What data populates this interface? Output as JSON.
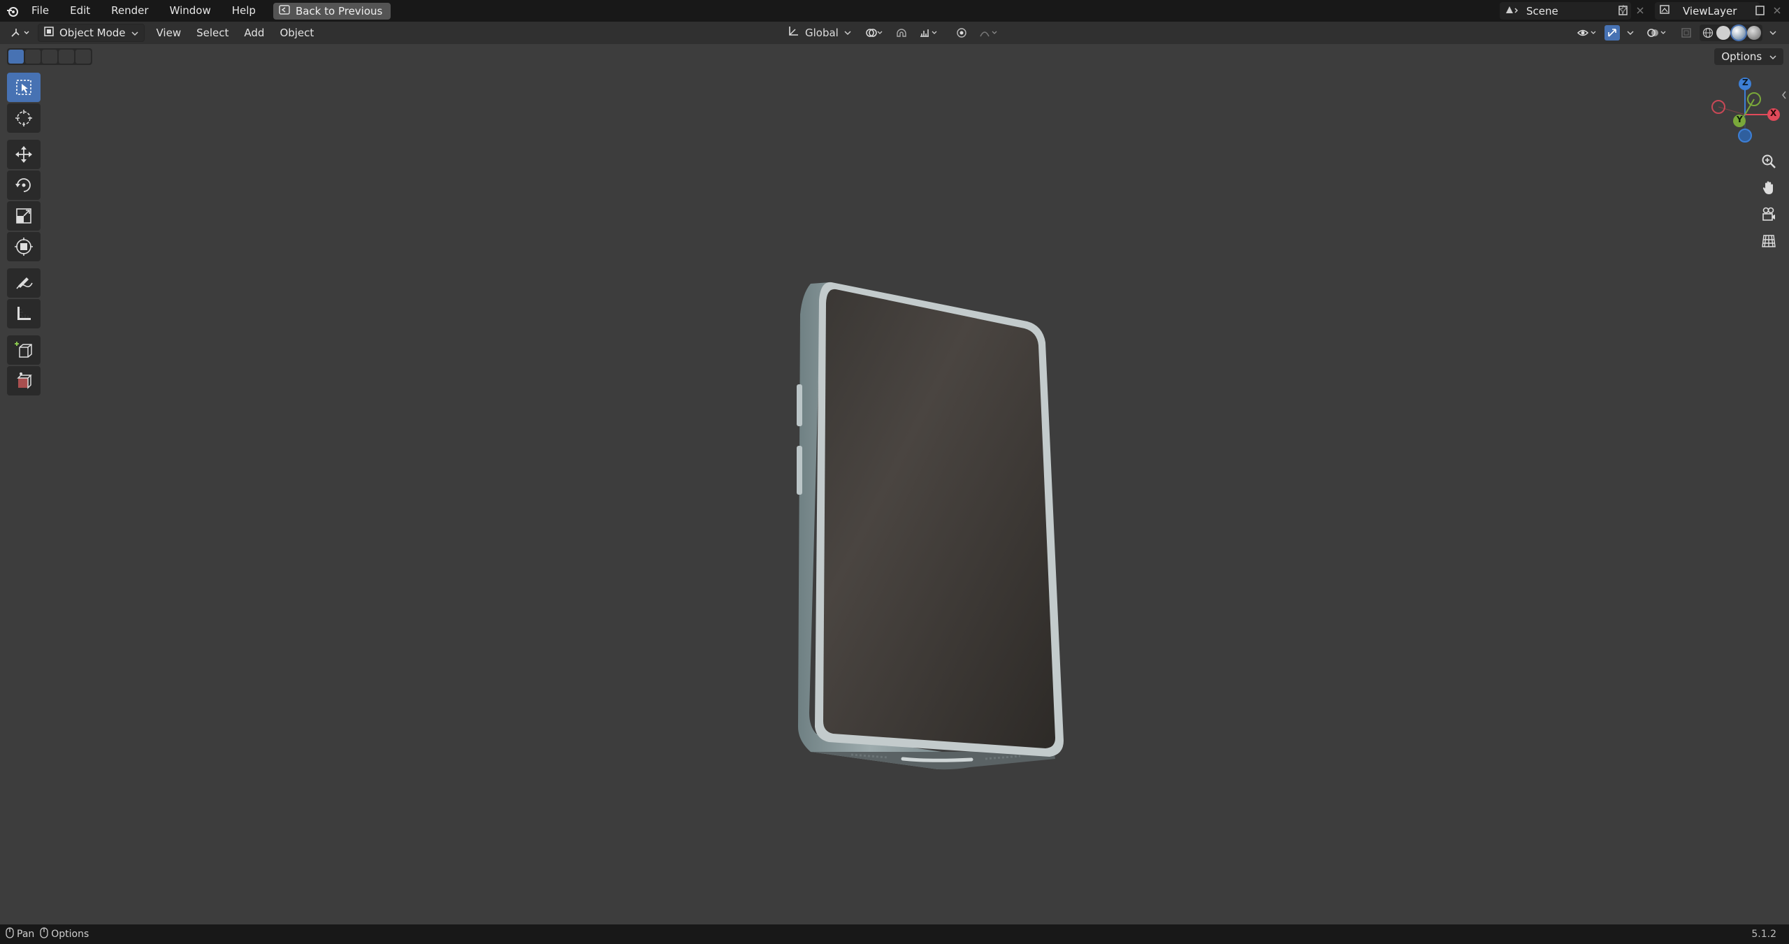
{
  "topbar": {
    "menu": [
      "File",
      "Edit",
      "Render",
      "Window",
      "Help"
    ],
    "back_button": "Back to Previous",
    "scene": "Scene",
    "view_layer": "ViewLayer"
  },
  "viewport_header": {
    "mode": "Object Mode",
    "menus": [
      "View",
      "Select",
      "Add",
      "Object"
    ],
    "orientation": "Global",
    "options": "Options"
  },
  "toolbar": {
    "tools": [
      "select-box",
      "cursor",
      "move",
      "rotate",
      "scale",
      "transform",
      "annotate",
      "measure",
      "add-cube",
      "add-cube-extrude"
    ]
  },
  "gizmo": {
    "x": "X",
    "y": "Y",
    "z": "Z"
  },
  "statusbar": {
    "pan": "Pan",
    "options": "Options",
    "version": "5.1.2"
  },
  "colors": {
    "background": "#3d3d3d",
    "topbar": "#181818",
    "header": "#303030",
    "accent": "#4772b3",
    "x_axis": "#e04a5a",
    "y_axis": "#7aa83a",
    "z_axis": "#3d7fd6"
  }
}
